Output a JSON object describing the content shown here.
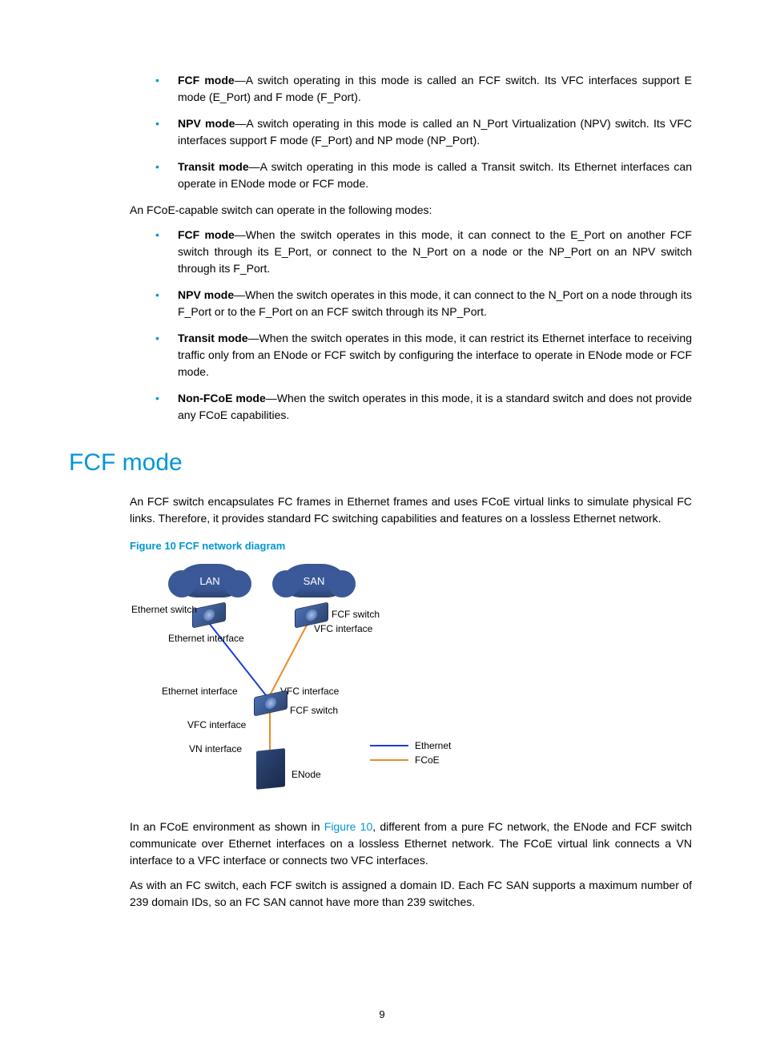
{
  "list1": {
    "b1_bold": "FCF mode",
    "b1_text": "—A switch operating in this mode is called an FCF switch. Its VFC interfaces support E mode (E_Port) and F mode (F_Port).",
    "b2_bold": "NPV mode",
    "b2_text": "—A switch operating in this mode is called an N_Port Virtualization (NPV) switch. Its VFC interfaces support F mode (F_Port) and NP mode (NP_Port).",
    "b3_bold": "Transit mode",
    "b3_text": "—A switch operating in this mode is called a Transit switch. Its Ethernet interfaces can operate in ENode mode or FCF mode."
  },
  "para1": "An FCoE-capable switch can operate in the following modes:",
  "list2": {
    "b1_bold": "FCF mode",
    "b1_text": "—When the switch operates in this mode, it can connect to the E_Port on another FCF switch through its E_Port, or connect to the N_Port on a node or the NP_Port on an NPV switch through its F_Port.",
    "b2_bold": "NPV mode",
    "b2_text": "—When the switch operates in this mode, it can connect to the N_Port on a node through its F_Port or to the F_Port on an FCF switch through its NP_Port.",
    "b3_bold": "Transit mode",
    "b3_text": "—When the switch operates in this mode, it can restrict its Ethernet interface to receiving traffic only from an ENode or FCF switch by configuring the interface to operate in ENode mode or FCF mode.",
    "b4_bold": "Non-FCoE mode",
    "b4_text": "—When the switch operates in this mode, it is a standard switch and does not provide any FCoE capabilities."
  },
  "section_heading": "FCF mode",
  "para2": "An FCF switch encapsulates FC frames in Ethernet frames and uses FCoE virtual links to simulate physical FC links. Therefore, it provides standard FC switching capabilities and features on a lossless Ethernet network.",
  "figure_caption": "Figure 10 FCF network diagram",
  "diagram": {
    "lan": "LAN",
    "san": "SAN",
    "eth_switch": "Ethernet switch",
    "fcf_switch1": "FCF switch",
    "eth_iface1": "Ethernet interface",
    "vfc_iface1": "VFC interface",
    "eth_iface2": "Ethernet interface",
    "vfc_iface2": "VFC interface",
    "fcf_switch2": "FCF switch",
    "vfc_iface3": "VFC interface",
    "vn_iface": "VN interface",
    "enode": "ENode",
    "legend_eth": "Ethernet",
    "legend_fcoe": "FCoE"
  },
  "para3_pre": "In an FCoE environment as shown in ",
  "para3_link": "Figure 10",
  "para3_post": ", different from a pure FC network, the ENode and FCF switch communicate over Ethernet interfaces on a lossless Ethernet network. The FCoE virtual link connects a VN interface to a VFC interface or connects two VFC interfaces.",
  "para4": "As with an FC switch, each FCF switch is assigned a domain ID. Each FC SAN supports a maximum number of 239 domain IDs, so an FC SAN cannot have more than 239 switches.",
  "page_number": "9"
}
